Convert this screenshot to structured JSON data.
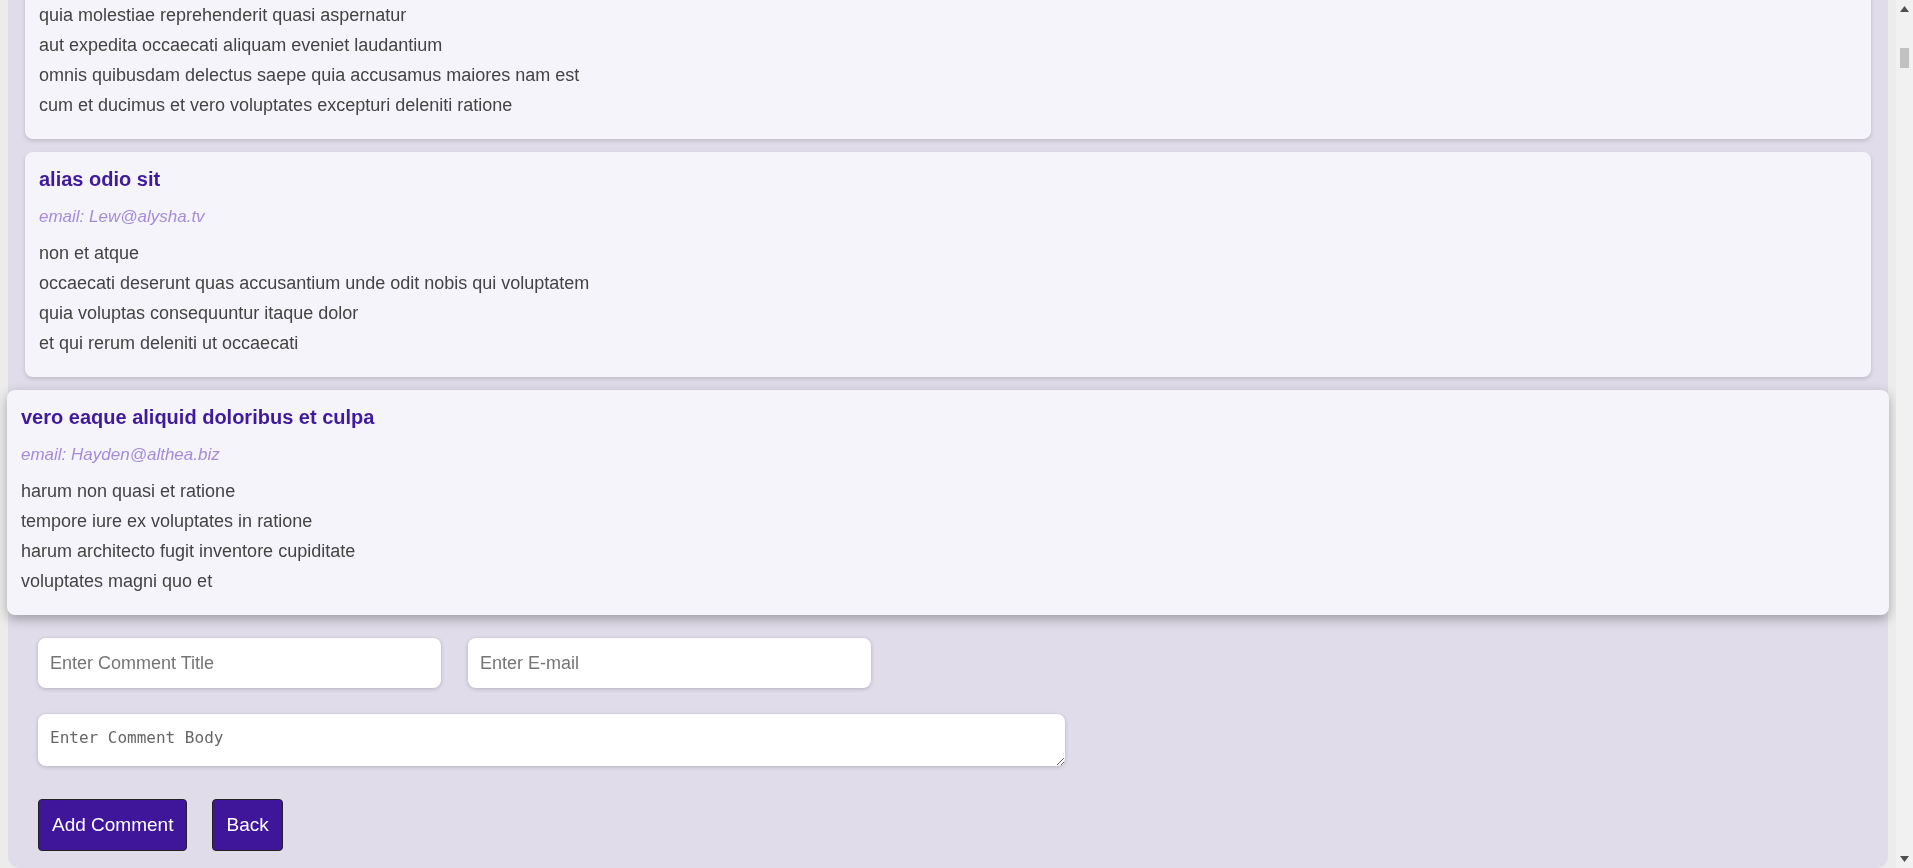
{
  "comments": [
    {
      "body": [
        "quia molestiae reprehenderit quasi aspernatur",
        "aut expedita occaecati aliquam eveniet laudantium",
        "omnis quibusdam delectus saepe quia accusamus maiores nam est",
        "cum et ducimus et vero voluptates excepturi deleniti ratione"
      ],
      "highlighted": false
    },
    {
      "title": "alias odio sit",
      "email": "email: Lew@alysha.tv",
      "body": [
        "non et atque",
        "occaecati deserunt quas accusantium unde odit nobis qui voluptatem",
        "quia voluptas consequuntur itaque dolor",
        "et qui rerum deleniti ut occaecati"
      ],
      "highlighted": false
    },
    {
      "title": "vero eaque aliquid doloribus et culpa",
      "email": "email: Hayden@althea.biz",
      "body": [
        "harum non quasi et ratione",
        "tempore iure ex voluptates in ratione",
        "harum architecto fugit inventore cupiditate",
        "voluptates magni quo et"
      ],
      "highlighted": true
    }
  ],
  "form": {
    "title_field": {
      "placeholder": "Enter Comment Title"
    },
    "email_field": {
      "placeholder": "Enter E-mail"
    },
    "body_field": {
      "placeholder": "Enter Comment Body"
    },
    "buttons": [
      "Add Comment",
      "Back"
    ]
  }
}
